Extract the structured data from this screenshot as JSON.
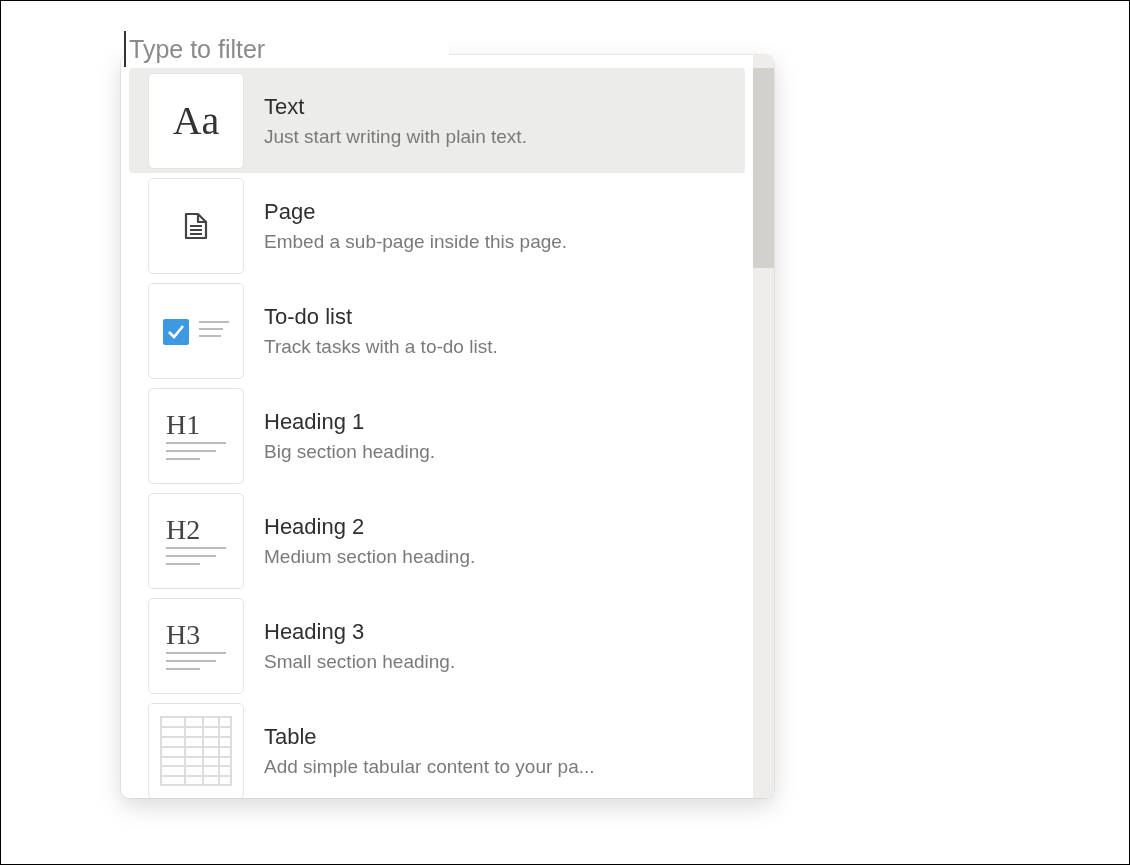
{
  "filter": {
    "placeholder": "Type to filter"
  },
  "menu_items": [
    {
      "kind": "glyph",
      "glyph": "Aa",
      "title": "Text",
      "description": "Just start writing with plain text.",
      "selected": true
    },
    {
      "kind": "page",
      "title": "Page",
      "description": "Embed a sub-page inside this page.",
      "selected": false
    },
    {
      "kind": "todo",
      "title": "To-do list",
      "description": "Track tasks with a to-do list.",
      "selected": false
    },
    {
      "kind": "heading",
      "glyph": "H1",
      "title": "Heading 1",
      "description": "Big section heading.",
      "selected": false
    },
    {
      "kind": "heading",
      "glyph": "H2",
      "title": "Heading 2",
      "description": "Medium section heading.",
      "selected": false
    },
    {
      "kind": "heading",
      "glyph": "H3",
      "title": "Heading 3",
      "description": "Small section heading.",
      "selected": false
    },
    {
      "kind": "table",
      "title": "Table",
      "description": "Add simple tabular content to your pa...",
      "selected": false
    }
  ]
}
